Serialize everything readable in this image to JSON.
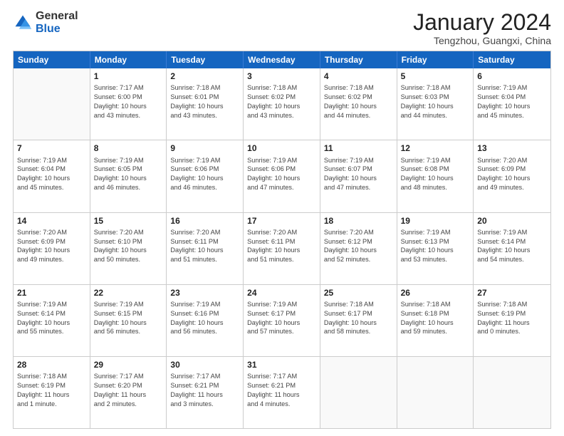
{
  "logo": {
    "general": "General",
    "blue": "Blue"
  },
  "title": "January 2024",
  "subtitle": "Tengzhou, Guangxi, China",
  "days": [
    "Sunday",
    "Monday",
    "Tuesday",
    "Wednesday",
    "Thursday",
    "Friday",
    "Saturday"
  ],
  "weeks": [
    [
      {
        "day": "",
        "info": ""
      },
      {
        "day": "1",
        "info": "Sunrise: 7:17 AM\nSunset: 6:00 PM\nDaylight: 10 hours\nand 43 minutes."
      },
      {
        "day": "2",
        "info": "Sunrise: 7:18 AM\nSunset: 6:01 PM\nDaylight: 10 hours\nand 43 minutes."
      },
      {
        "day": "3",
        "info": "Sunrise: 7:18 AM\nSunset: 6:02 PM\nDaylight: 10 hours\nand 43 minutes."
      },
      {
        "day": "4",
        "info": "Sunrise: 7:18 AM\nSunset: 6:02 PM\nDaylight: 10 hours\nand 44 minutes."
      },
      {
        "day": "5",
        "info": "Sunrise: 7:18 AM\nSunset: 6:03 PM\nDaylight: 10 hours\nand 44 minutes."
      },
      {
        "day": "6",
        "info": "Sunrise: 7:19 AM\nSunset: 6:04 PM\nDaylight: 10 hours\nand 45 minutes."
      }
    ],
    [
      {
        "day": "7",
        "info": "Sunrise: 7:19 AM\nSunset: 6:04 PM\nDaylight: 10 hours\nand 45 minutes."
      },
      {
        "day": "8",
        "info": "Sunrise: 7:19 AM\nSunset: 6:05 PM\nDaylight: 10 hours\nand 46 minutes."
      },
      {
        "day": "9",
        "info": "Sunrise: 7:19 AM\nSunset: 6:06 PM\nDaylight: 10 hours\nand 46 minutes."
      },
      {
        "day": "10",
        "info": "Sunrise: 7:19 AM\nSunset: 6:06 PM\nDaylight: 10 hours\nand 47 minutes."
      },
      {
        "day": "11",
        "info": "Sunrise: 7:19 AM\nSunset: 6:07 PM\nDaylight: 10 hours\nand 47 minutes."
      },
      {
        "day": "12",
        "info": "Sunrise: 7:19 AM\nSunset: 6:08 PM\nDaylight: 10 hours\nand 48 minutes."
      },
      {
        "day": "13",
        "info": "Sunrise: 7:20 AM\nSunset: 6:09 PM\nDaylight: 10 hours\nand 49 minutes."
      }
    ],
    [
      {
        "day": "14",
        "info": "Sunrise: 7:20 AM\nSunset: 6:09 PM\nDaylight: 10 hours\nand 49 minutes."
      },
      {
        "day": "15",
        "info": "Sunrise: 7:20 AM\nSunset: 6:10 PM\nDaylight: 10 hours\nand 50 minutes."
      },
      {
        "day": "16",
        "info": "Sunrise: 7:20 AM\nSunset: 6:11 PM\nDaylight: 10 hours\nand 51 minutes."
      },
      {
        "day": "17",
        "info": "Sunrise: 7:20 AM\nSunset: 6:11 PM\nDaylight: 10 hours\nand 51 minutes."
      },
      {
        "day": "18",
        "info": "Sunrise: 7:20 AM\nSunset: 6:12 PM\nDaylight: 10 hours\nand 52 minutes."
      },
      {
        "day": "19",
        "info": "Sunrise: 7:19 AM\nSunset: 6:13 PM\nDaylight: 10 hours\nand 53 minutes."
      },
      {
        "day": "20",
        "info": "Sunrise: 7:19 AM\nSunset: 6:14 PM\nDaylight: 10 hours\nand 54 minutes."
      }
    ],
    [
      {
        "day": "21",
        "info": "Sunrise: 7:19 AM\nSunset: 6:14 PM\nDaylight: 10 hours\nand 55 minutes."
      },
      {
        "day": "22",
        "info": "Sunrise: 7:19 AM\nSunset: 6:15 PM\nDaylight: 10 hours\nand 56 minutes."
      },
      {
        "day": "23",
        "info": "Sunrise: 7:19 AM\nSunset: 6:16 PM\nDaylight: 10 hours\nand 56 minutes."
      },
      {
        "day": "24",
        "info": "Sunrise: 7:19 AM\nSunset: 6:17 PM\nDaylight: 10 hours\nand 57 minutes."
      },
      {
        "day": "25",
        "info": "Sunrise: 7:18 AM\nSunset: 6:17 PM\nDaylight: 10 hours\nand 58 minutes."
      },
      {
        "day": "26",
        "info": "Sunrise: 7:18 AM\nSunset: 6:18 PM\nDaylight: 10 hours\nand 59 minutes."
      },
      {
        "day": "27",
        "info": "Sunrise: 7:18 AM\nSunset: 6:19 PM\nDaylight: 11 hours\nand 0 minutes."
      }
    ],
    [
      {
        "day": "28",
        "info": "Sunrise: 7:18 AM\nSunset: 6:19 PM\nDaylight: 11 hours\nand 1 minute."
      },
      {
        "day": "29",
        "info": "Sunrise: 7:17 AM\nSunset: 6:20 PM\nDaylight: 11 hours\nand 2 minutes."
      },
      {
        "day": "30",
        "info": "Sunrise: 7:17 AM\nSunset: 6:21 PM\nDaylight: 11 hours\nand 3 minutes."
      },
      {
        "day": "31",
        "info": "Sunrise: 7:17 AM\nSunset: 6:21 PM\nDaylight: 11 hours\nand 4 minutes."
      },
      {
        "day": "",
        "info": ""
      },
      {
        "day": "",
        "info": ""
      },
      {
        "day": "",
        "info": ""
      }
    ]
  ]
}
